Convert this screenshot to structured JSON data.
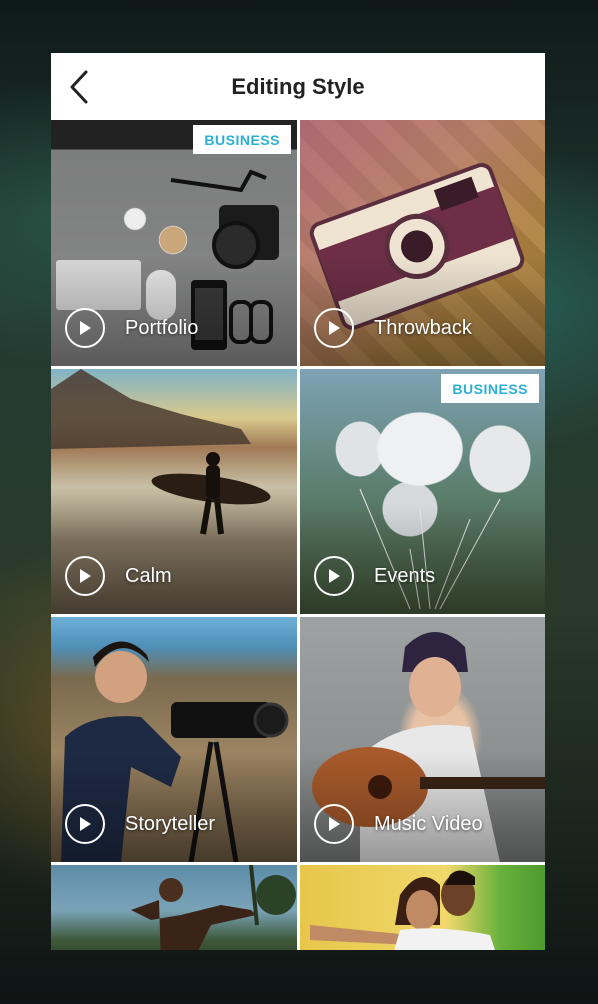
{
  "header": {
    "title": "Editing Style",
    "back_icon": "chevron-left-icon"
  },
  "tiles": [
    {
      "label": "Portfolio",
      "badge": "BUSINESS",
      "icon": "play-icon"
    },
    {
      "label": "Throwback",
      "badge": "",
      "icon": "play-icon"
    },
    {
      "label": "Calm",
      "badge": "",
      "icon": "play-icon"
    },
    {
      "label": "Events",
      "badge": "BUSINESS",
      "icon": "play-icon"
    },
    {
      "label": "Storyteller",
      "badge": "",
      "icon": "play-icon"
    },
    {
      "label": "Music Video",
      "badge": "",
      "icon": "play-icon"
    },
    {
      "label": "",
      "badge": "",
      "icon": ""
    },
    {
      "label": "",
      "badge": "",
      "icon": ""
    }
  ],
  "colors": {
    "badge_text": "#2ab0d4",
    "title_text": "#222222",
    "label_text": "#ffffff"
  }
}
